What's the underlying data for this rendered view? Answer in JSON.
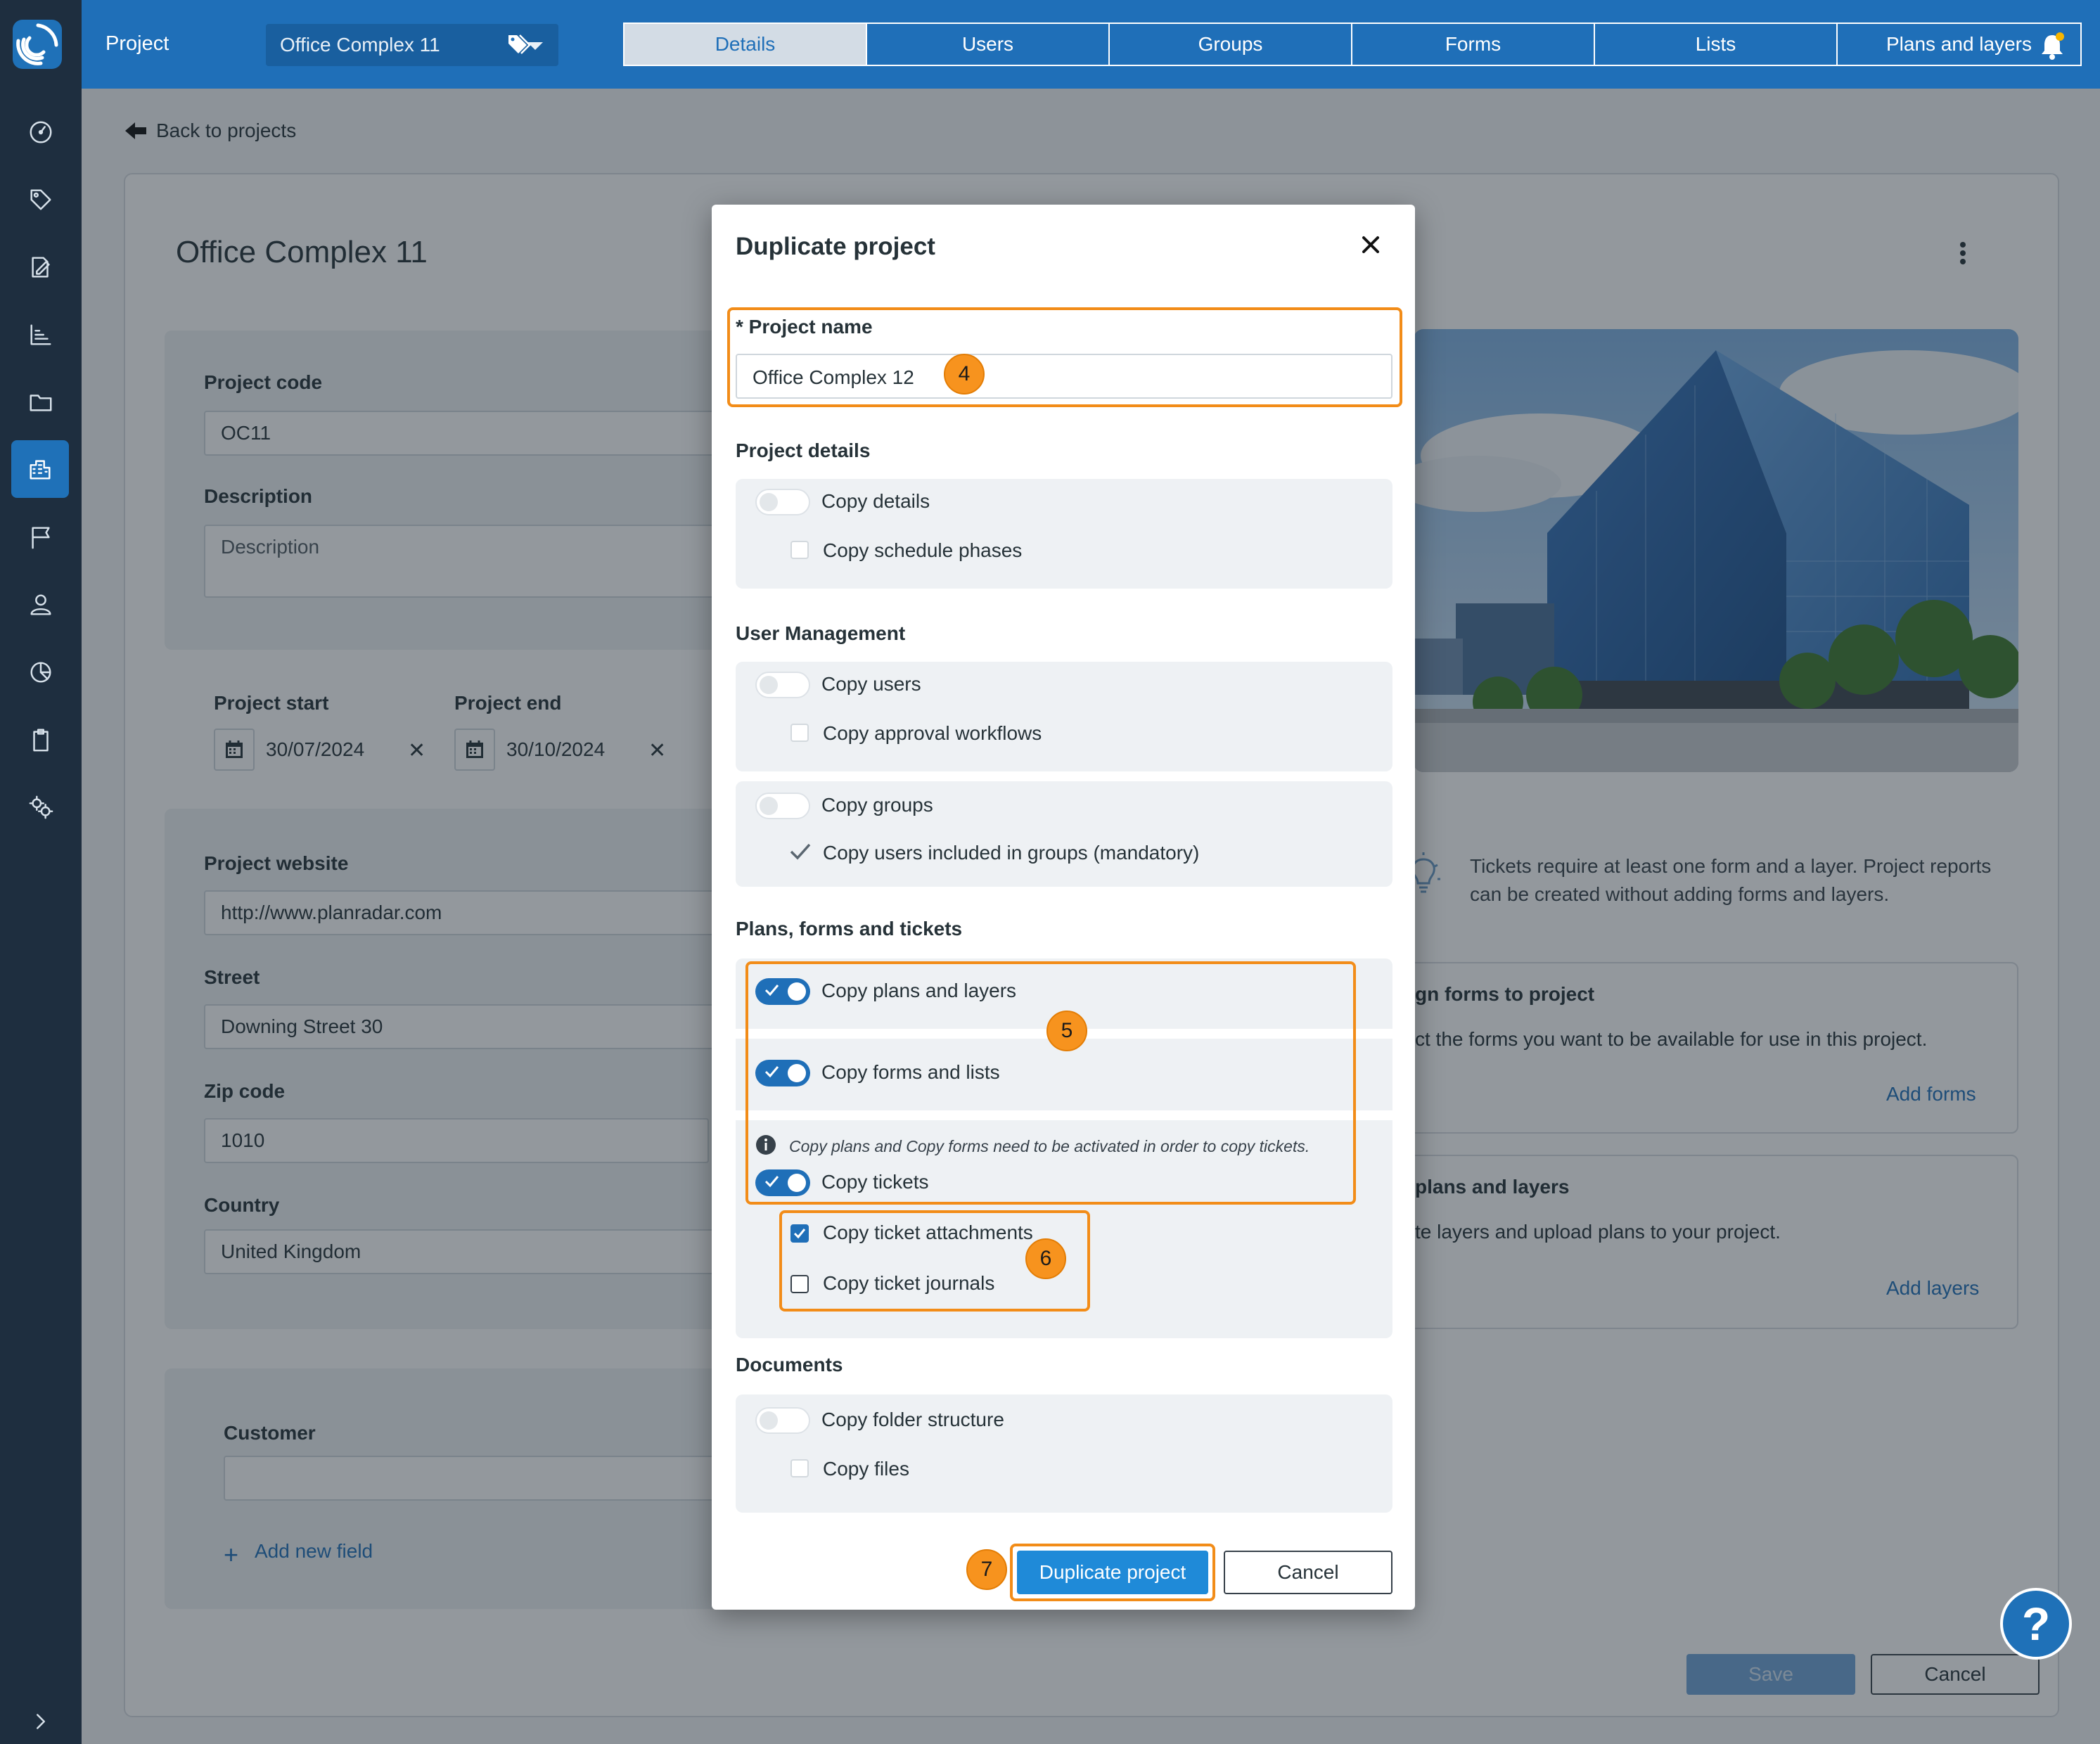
{
  "topbar": {
    "project_label": "Project",
    "project_selected": "Office Complex 11",
    "tabs": [
      "Details",
      "Users",
      "Groups",
      "Forms",
      "Lists",
      "Plans and layers"
    ]
  },
  "page": {
    "back_link": "Back to projects",
    "title": "Office Complex 11",
    "project_code_label": "Project code",
    "project_code_value": "OC11",
    "description_label": "Description",
    "description_placeholder": "Description",
    "project_start_label": "Project start",
    "project_start_value": "30/07/2024",
    "project_end_label": "Project end",
    "project_end_value": "30/10/2024",
    "website_label": "Project website",
    "website_value": "http://www.planradar.com",
    "street_label": "Street",
    "street_value": "Downing Street 30",
    "zip_label": "Zip code",
    "zip_value": "1010",
    "country_label": "Country",
    "country_value": "United Kingdom",
    "customer_label": "Customer",
    "add_field": "Add new field",
    "info_text_1": "Tickets require at least one form and a layer. Project reports",
    "info_text_2": "can be created without adding forms and layers.",
    "forms_card_title": "gn forms to project",
    "forms_card_text": "ct the forms you want to be available for use in this project.",
    "forms_card_link": "Add forms",
    "layers_card_title": "plans and layers",
    "layers_card_text": "te layers and upload plans to your project.",
    "layers_card_link": "Add layers",
    "save": "Save",
    "cancel": "Cancel"
  },
  "modal": {
    "title": "Duplicate project",
    "name_label": "* Project name",
    "name_value": "Office Complex 12",
    "sec_details": "Project details",
    "copy_details": "Copy details",
    "copy_schedule": "Copy schedule phases",
    "sec_users": "User Management",
    "copy_users": "Copy users",
    "copy_approval": "Copy approval workflows",
    "copy_groups": "Copy groups",
    "copy_users_groups": "Copy users included in groups (mandatory)",
    "sec_plans": "Plans, forms and tickets",
    "copy_plans": "Copy plans and layers",
    "copy_forms": "Copy forms and lists",
    "tickets_note": "Copy plans and Copy forms need to be activated in order to copy tickets.",
    "copy_tickets": "Copy tickets",
    "copy_attachments": "Copy ticket attachments",
    "copy_journals": "Copy ticket journals",
    "sec_documents": "Documents",
    "copy_folders": "Copy folder structure",
    "copy_files": "Copy files",
    "duplicate_btn": "Duplicate project",
    "cancel_btn": "Cancel"
  },
  "markers": [
    "4",
    "5",
    "6",
    "7"
  ],
  "help_glyph": "?",
  "colors": {
    "brand": "#1f6fb8",
    "sidebar": "#1e2e3f",
    "highlight": "#f28c18"
  }
}
